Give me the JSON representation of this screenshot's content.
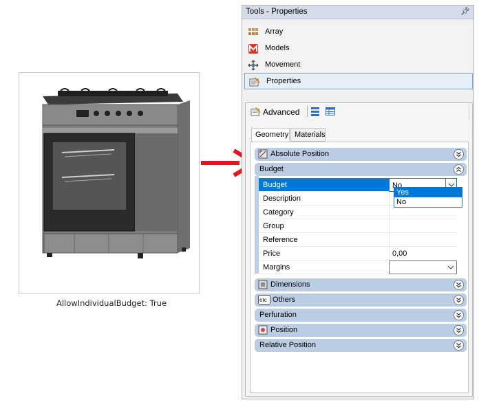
{
  "caption": "AllowIndividualBudget: True",
  "panel": {
    "title": "Tools - Properties",
    "pin_glyph": "↑"
  },
  "nav": [
    {
      "label": "Array",
      "icon": "array-icon"
    },
    {
      "label": "Models",
      "icon": "models-icon"
    },
    {
      "label": "Movement",
      "icon": "movement-icon"
    },
    {
      "label": "Properties",
      "icon": "properties-icon",
      "selected": true
    }
  ],
  "toolbar": {
    "advanced_label": "Advanced"
  },
  "tabs": {
    "geometry": "Geometry",
    "materials": "Materials"
  },
  "categories": {
    "absolute_position": "Absolute Position",
    "budget": "Budget",
    "dimensions": "Dimensions",
    "others": "Others",
    "perfuration": "Perfuration",
    "position": "Position",
    "relative_position": "Relative Position"
  },
  "budget_rows": {
    "budget": {
      "name": "Budget",
      "value": "No"
    },
    "description": {
      "name": "Description",
      "value": ""
    },
    "category": {
      "name": "Category",
      "value": ""
    },
    "group": {
      "name": "Group",
      "value": ""
    },
    "reference": {
      "name": "Reference",
      "value": ""
    },
    "price": {
      "name": "Price",
      "value": "0,00"
    },
    "margins": {
      "name": "Margins",
      "value": ""
    }
  },
  "dropdown": {
    "options": [
      "Yes",
      "No"
    ],
    "highlighted": "Yes"
  },
  "colors": {
    "arrow": "#e8141b",
    "selection": "#0078d7",
    "category_bg": "#bccde3"
  }
}
